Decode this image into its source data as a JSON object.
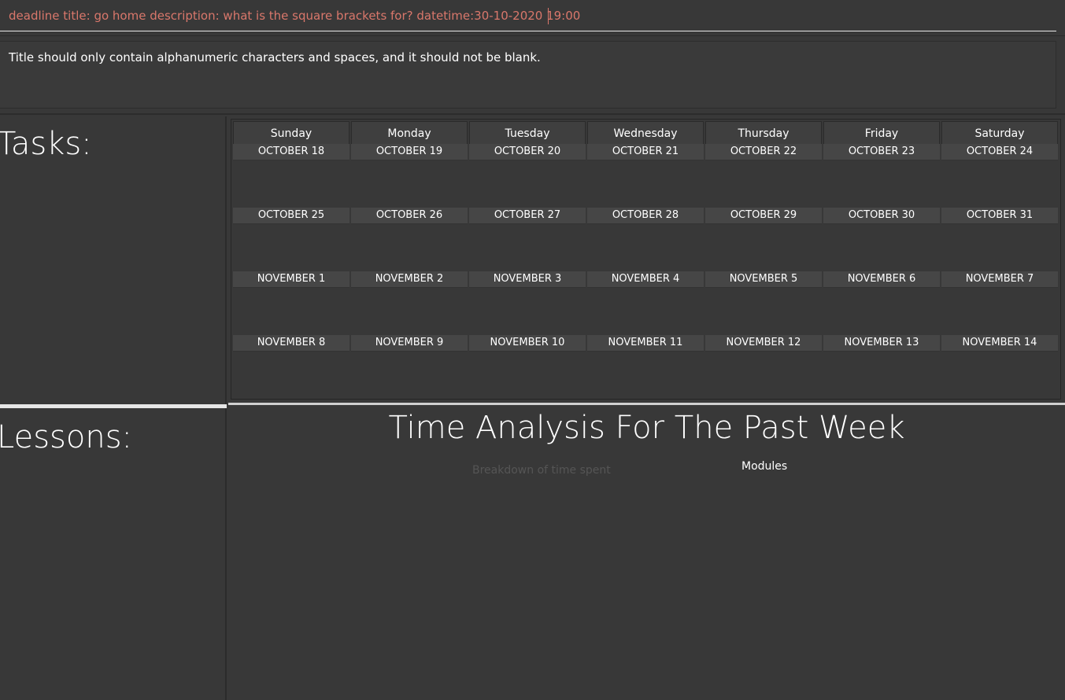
{
  "command_box": {
    "value": "deadline title: go home description: what is the square brackets for? datetime:30-10-2020 19:00"
  },
  "result_display": {
    "message": "Title should only contain alphanumeric characters and spaces, and it should not be blank."
  },
  "tasks_panel": {
    "title": "Tasks:"
  },
  "lessons_panel": {
    "title": "Lessons:"
  },
  "calendar": {
    "days": [
      "Sunday",
      "Monday",
      "Tuesday",
      "Wednesday",
      "Thursday",
      "Friday",
      "Saturday"
    ],
    "weeks": [
      [
        "OCTOBER 18",
        "OCTOBER 19",
        "OCTOBER 20",
        "OCTOBER 21",
        "OCTOBER 22",
        "OCTOBER 23",
        "OCTOBER 24"
      ],
      [
        "OCTOBER 25",
        "OCTOBER 26",
        "OCTOBER 27",
        "OCTOBER 28",
        "OCTOBER 29",
        "OCTOBER 30",
        "OCTOBER 31"
      ],
      [
        "NOVEMBER 1",
        "NOVEMBER 2",
        "NOVEMBER 3",
        "NOVEMBER 4",
        "NOVEMBER 5",
        "NOVEMBER 6",
        "NOVEMBER 7"
      ],
      [
        "NOVEMBER 8",
        "NOVEMBER 9",
        "NOVEMBER 10",
        "NOVEMBER 11",
        "NOVEMBER 12",
        "NOVEMBER 13",
        "NOVEMBER 14"
      ]
    ]
  },
  "analysis": {
    "title": "Time Analysis For The Past Week",
    "chart_title": "Breakdown of time spent",
    "legend_title": "Modules"
  },
  "colors": {
    "background": "#383838",
    "command_text": "#d9776b",
    "text": "#ffffff",
    "date_cell": "#464646",
    "chart_title": "#555555"
  }
}
